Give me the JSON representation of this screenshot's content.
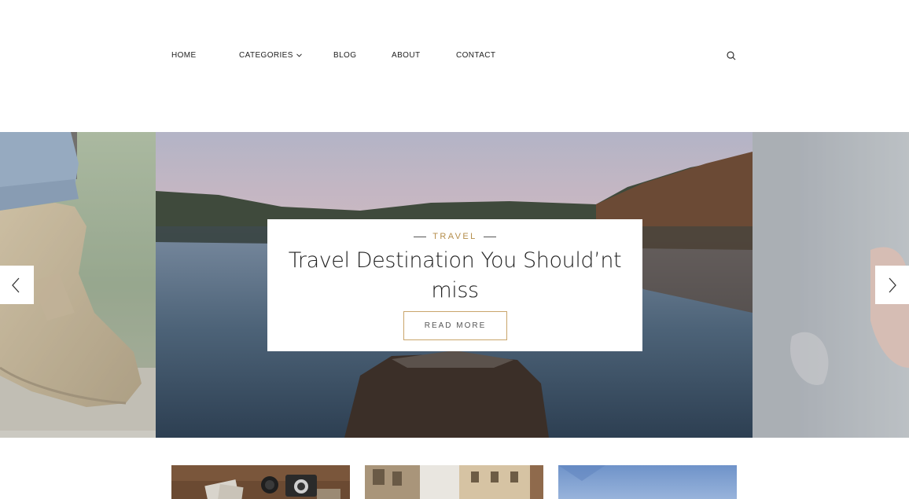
{
  "nav": {
    "items": [
      {
        "label": "HOME"
      },
      {
        "label": "CATEGORIES"
      },
      {
        "label": "BLOG"
      },
      {
        "label": "ABOUT"
      },
      {
        "label": "CONTACT"
      }
    ],
    "icons": {
      "dropdown": "chevron-down-icon",
      "search": "search-icon"
    }
  },
  "slider": {
    "category": "TRAVEL",
    "title": "Travel Destination You Should’nt miss",
    "cta": "READ MORE",
    "icons": {
      "prev": "chevron-left-icon",
      "next": "chevron-right-icon"
    },
    "colors": {
      "accent": "#b48d4a",
      "button_border": "#c9a56b"
    }
  }
}
